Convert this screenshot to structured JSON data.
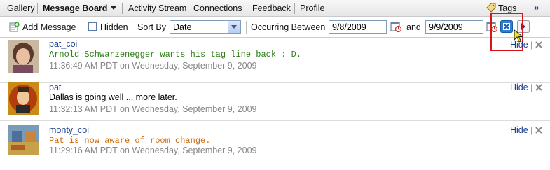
{
  "nav": {
    "items": [
      "Gallery",
      "Message Board",
      "Activity Stream",
      "Connections",
      "Feedback",
      "Profile"
    ],
    "tags_label": "Tags",
    "more_label": "»"
  },
  "toolbar": {
    "add_message": "Add Message",
    "hidden_label": "Hidden",
    "hidden_checked": false,
    "sort_by_label": "Sort By",
    "sort_value": "Date",
    "occurring_between_label": "Occurring Between",
    "start_date": "9/8/2009",
    "and_label": "and",
    "end_date": "9/9/2009"
  },
  "messages": [
    {
      "author": "pat_coi",
      "text": "Arnold Schwarzenegger wants his tag line back : D.",
      "text_color": "#2e7d1a",
      "timestamp": "11:36:49 AM PDT on Wednesday, September 9, 2009",
      "hide_label": "Hide"
    },
    {
      "author": "pat",
      "text": "Dallas is going well ... more later.",
      "text_color": "#000000",
      "timestamp": "11:32:13 AM PDT on Wednesday, September 9, 2009",
      "hide_label": "Hide"
    },
    {
      "author": "monty_coi",
      "text": "Pat is now aware of room change.",
      "text_color": "#d06a0a",
      "timestamp": "11:29:16 AM PDT on Wednesday, September 9, 2009",
      "hide_label": "Hide"
    }
  ]
}
